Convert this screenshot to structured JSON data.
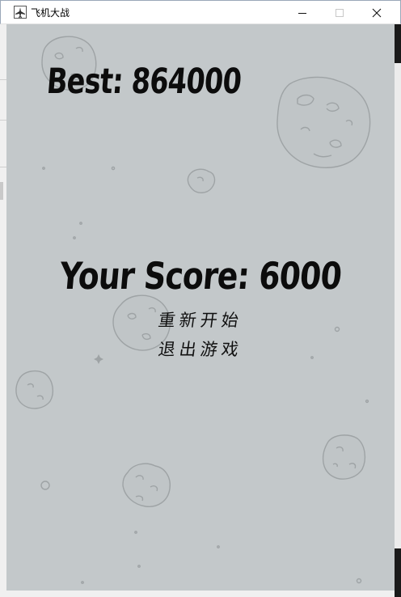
{
  "window": {
    "title": "飞机大战",
    "icon": "plane-game-icon",
    "controls": [
      "minimize-icon",
      "maximize-icon",
      "close-icon"
    ]
  },
  "game": {
    "background_color": "#c3c8ca",
    "best_label": "Best: 864000",
    "score_label": "Your Score: 6000",
    "menu": {
      "restart": "重新开始",
      "quit": "退出游戏"
    }
  }
}
